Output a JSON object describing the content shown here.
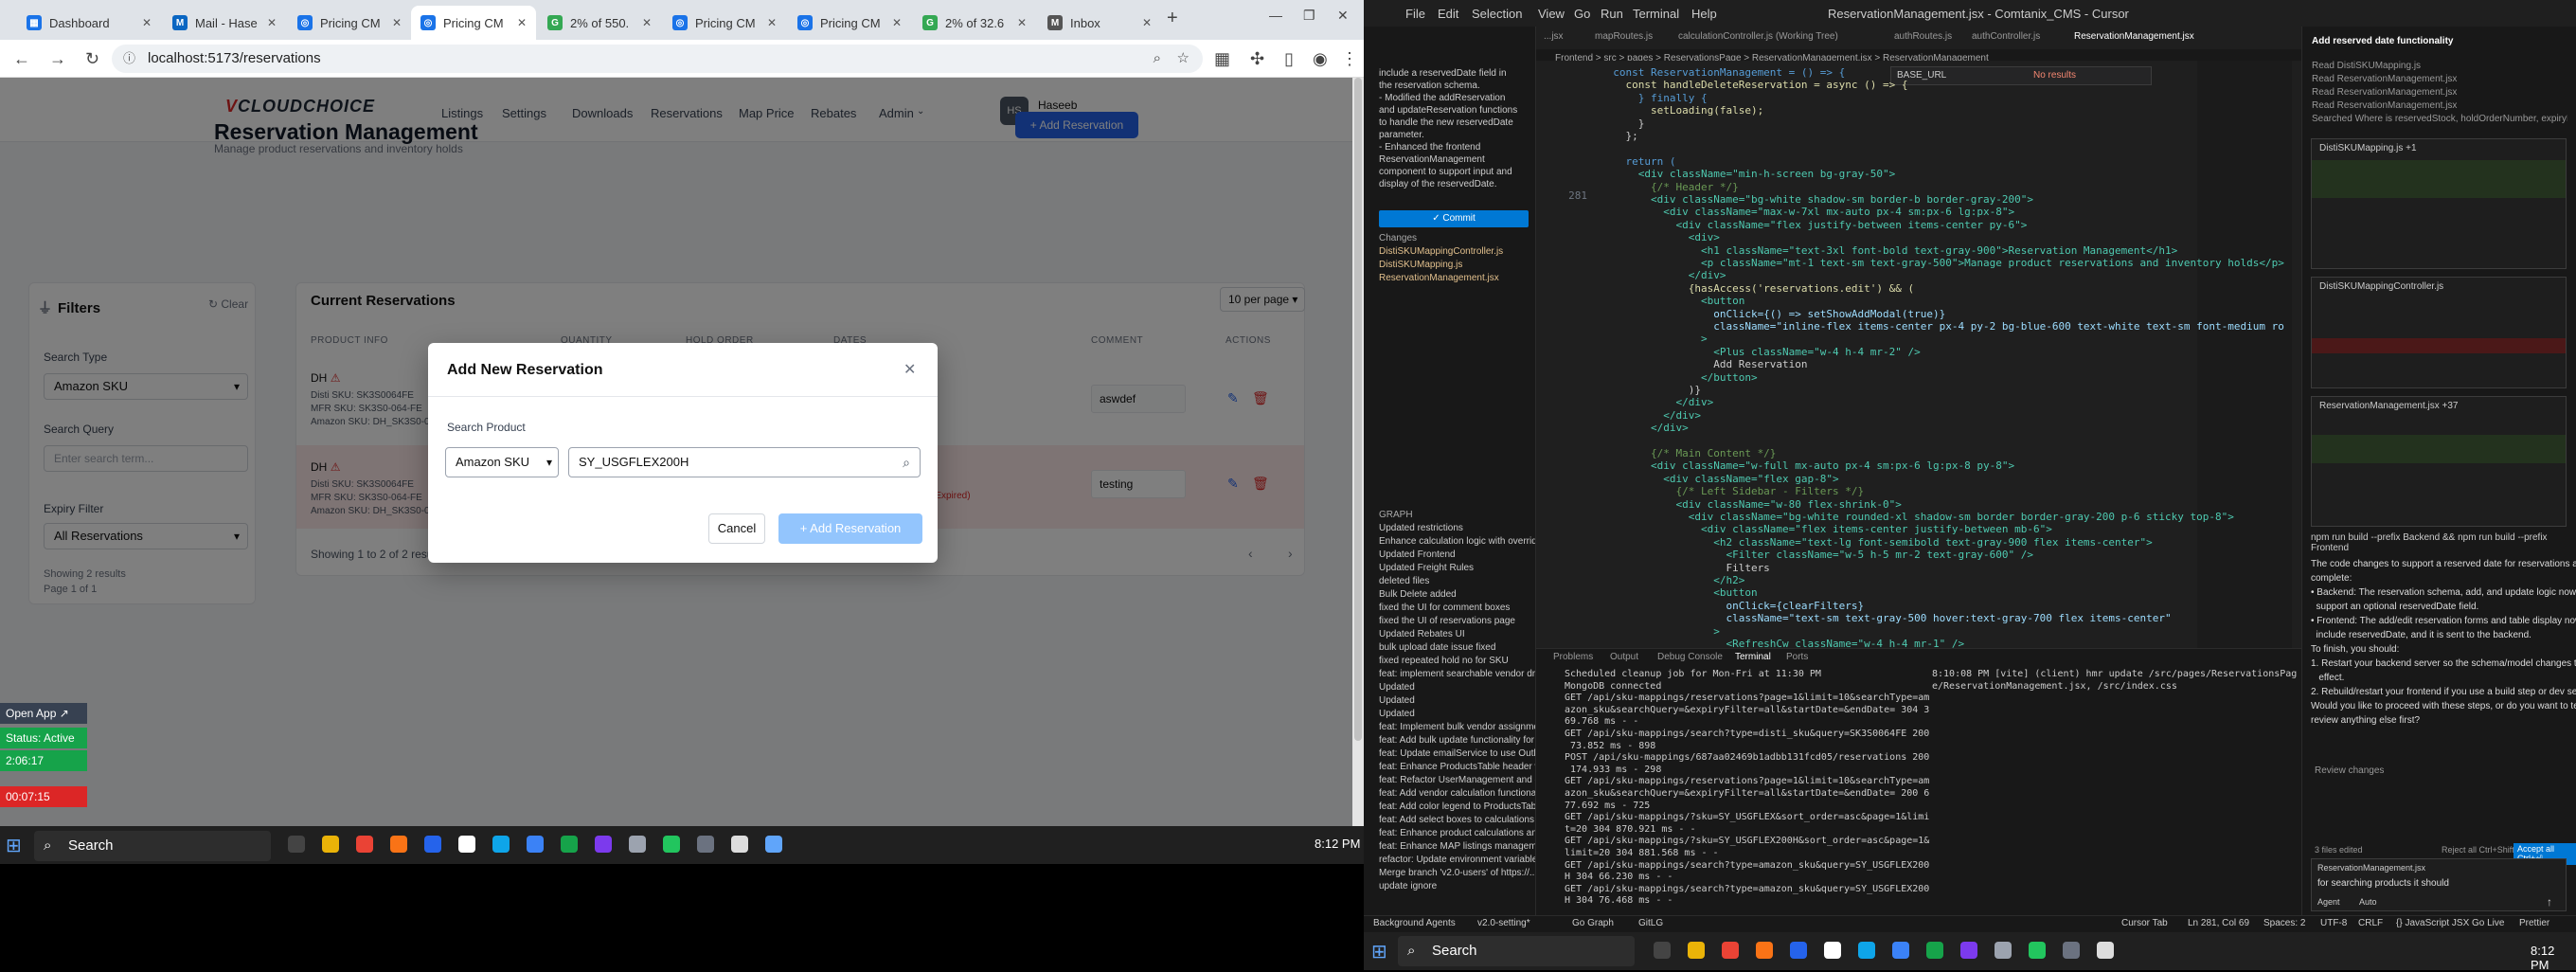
{
  "browser": {
    "tabs": [
      {
        "label": "Dashboard",
        "color": "#1a73e8"
      },
      {
        "label": "Mail - Hase",
        "color": "#0a66c2"
      },
      {
        "label": "Pricing CM",
        "color": "#1a73e8"
      },
      {
        "label": "Pricing CM",
        "color": "#1a73e8"
      },
      {
        "label": "2% of 550.",
        "color": "#34a853"
      },
      {
        "label": "Pricing CM",
        "color": "#1a73e8"
      },
      {
        "label": "Pricing CM",
        "color": "#1a73e8"
      },
      {
        "label": "2% of 32.6",
        "color": "#34a853"
      },
      {
        "label": "Inbox",
        "color": "#555"
      }
    ],
    "url": "localhost:5173/reservations"
  },
  "app": {
    "logo_v": "V",
    "logo_text": "CLOUDCHOICE",
    "nav": [
      "Listings",
      "Settings",
      "Downloads",
      "Reservations",
      "Map Price",
      "Rebates",
      "Admin"
    ],
    "user": {
      "initials": "HS",
      "name": "Haseeb Shah...",
      "role": "admin"
    },
    "title": "Reservation Management",
    "subtitle": "Manage product reservations and inventory holds",
    "add_button": "+ Add Reservation",
    "filters": {
      "title": "Filters",
      "clear": "Clear",
      "search_type_label": "Search Type",
      "search_type_value": "Amazon SKU",
      "search_query_label": "Search Query",
      "search_query_placeholder": "Enter search term...",
      "expiry_label": "Expiry Filter",
      "expiry_value": "All Reservations",
      "results": "Showing 2 results",
      "page": "Page 1 of 1"
    },
    "table": {
      "title": "Current Reservations",
      "per_page": "10 per page",
      "headers": [
        "PRODUCT INFO",
        "QUANTITY",
        "HOLD ORDER",
        "DATES",
        "COMMENT",
        "ACTIONS"
      ],
      "rows": [
        {
          "name": "DH",
          "l1": "Disti SKU: SK3S0064FE",
          "l2": "MFR SKU: SK3S0-064-FE",
          "l3": "Amazon SKU: DH_SK3S0-064...",
          "comment": "aswdef",
          "bg": "#ffffff",
          "note": ""
        },
        {
          "name": "DH",
          "l1": "Disti SKU: SK3S0064FE",
          "l2": "MFR SKU: SK3S0-064-FE",
          "l3": "Amazon SKU: DH_SK3S0-064...",
          "comment": "testing",
          "bg": "#fde8e8",
          "note": "(Expired)"
        }
      ],
      "showing": "Showing 1 to 2 of 2 results"
    },
    "modal": {
      "title": "Add New Reservation",
      "search_label": "Search Product",
      "type_value": "Amazon SKU",
      "query_value": "SY_USGFLEX200H",
      "cancel": "Cancel",
      "add": "+ Add Reservation"
    },
    "widget": {
      "open": "Open App ↗",
      "status": "Status: Active",
      "t1": "2:06:17",
      "t2": "00:07:15"
    }
  },
  "taskbar_left": {
    "search": "Search",
    "time": "8:12 PM"
  },
  "vscode": {
    "menu": [
      "File",
      "Edit",
      "Selection",
      "View",
      "Go",
      "Run",
      "Terminal",
      "Help"
    ],
    "window_title": "ReservationManagement.jsx - Comtanix_CMS - Cursor",
    "tabs": [
      "...jsx",
      "mapRoutes.js",
      "calculationController.js (Working Tree)",
      "authRoutes.js",
      "authController.js",
      "ReservationManagement.jsx"
    ],
    "breadcrumb": "Frontend > src > pages > ReservationsPage > ReservationManagement.jsx > ReservationManagement",
    "find_value": "BASE_URL",
    "find_result": "No results",
    "sidebar_msg": [
      "include a reservedDate field in",
      "the reservation schema.",
      "- Modified the addReservation",
      "and updateReservation functions",
      "to handle the new reservedDate",
      "parameter.",
      "- Enhanced the frontend",
      "ReservationManagement",
      "component to support input and",
      "display of the reservedDate."
    ],
    "commit": "✓ Commit",
    "changes_title": "Changes",
    "changes": [
      "DistiSKUMappingController.js",
      "DistiSKUMapping.js",
      "ReservationManagement.jsx"
    ],
    "graph_title": "GRAPH",
    "graph": [
      "Updated restrictions",
      "Enhance calculation logic with override...",
      "Updated Frontend",
      "Updated Freight Rules",
      "deleted files",
      "Bulk Delete added",
      "fixed the UI for comment boxes",
      "fixed the UI of reservations page",
      "Updated Rebates UI",
      "bulk upload date issue fixed",
      "fixed repeated hold no for SKU",
      "feat: implement searchable vendor dro...",
      "Updated",
      "Updated",
      "Updated",
      "feat: Implement bulk vendor assignmen...",
      "feat: Add bulk update functionality for ...",
      "feat: Update emailService to use Outlook...",
      "feat: Enhance ProductsTable header wit...",
      "feat: Refactor UserManagement and en...",
      "feat: Add vendor calculation functional...",
      "feat: Add color legend to ProductsTable...",
      "feat: Add select boxes to calculations to...",
      "feat: Enhance product calculations and ...",
      "feat: Enhance MAP listings managemen...",
      "refactor: Update environment variable ...",
      "Merge branch 'v2.0-users' of https://...",
      "update ignore"
    ],
    "lines": [
      "281"
    ],
    "code": [
      {
        "t": "  const ReservationManagement = () => {",
        "c": "kw"
      },
      {
        "t": "    const handleDeleteReservation = async () => {",
        "c": "fn"
      },
      {
        "t": "      } finally {",
        "c": "kw"
      },
      {
        "t": "        setLoading(false);",
        "c": "fn"
      },
      {
        "t": "      }",
        "c": ""
      },
      {
        "t": "    };",
        "c": ""
      },
      {
        "t": "",
        "c": ""
      },
      {
        "t": "    return (",
        "c": "kw"
      },
      {
        "t": "      <div className=\"min-h-screen bg-gray-50\">",
        "c": "tag"
      },
      {
        "t": "        {/* Header */}",
        "c": "cm"
      },
      {
        "t": "        <div className=\"bg-white shadow-sm border-b border-gray-200\">",
        "c": "tag"
      },
      {
        "t": "          <div className=\"max-w-7xl mx-auto px-4 sm:px-6 lg:px-8\">",
        "c": "tag"
      },
      {
        "t": "            <div className=\"flex justify-between items-center py-6\">",
        "c": "tag"
      },
      {
        "t": "              <div>",
        "c": "tag"
      },
      {
        "t": "                <h1 className=\"text-3xl font-bold text-gray-900\">Reservation Management</h1>",
        "c": "tag"
      },
      {
        "t": "                <p className=\"mt-1 text-sm text-gray-500\">Manage product reservations and inventory holds</p>",
        "c": "tag"
      },
      {
        "t": "              </div>",
        "c": "tag"
      },
      {
        "t": "              {hasAccess('reservations.edit') && (",
        "c": "fn"
      },
      {
        "t": "                <button",
        "c": "tag"
      },
      {
        "t": "                  onClick={() => setShowAddModal(true)}",
        "c": "at"
      },
      {
        "t": "                  className=\"inline-flex items-center px-4 py-2 bg-blue-600 text-white text-sm font-medium ro",
        "c": "at"
      },
      {
        "t": "                >",
        "c": "tag"
      },
      {
        "t": "                  <Plus className=\"w-4 h-4 mr-2\" />",
        "c": "tag"
      },
      {
        "t": "                  Add Reservation",
        "c": ""
      },
      {
        "t": "                </button>",
        "c": "tag"
      },
      {
        "t": "              )}",
        "c": ""
      },
      {
        "t": "            </div>",
        "c": "tag"
      },
      {
        "t": "          </div>",
        "c": "tag"
      },
      {
        "t": "        </div>",
        "c": "tag"
      },
      {
        "t": "",
        "c": ""
      },
      {
        "t": "        {/* Main Content */}",
        "c": "cm"
      },
      {
        "t": "        <div className=\"w-full mx-auto px-4 sm:px-6 lg:px-8 py-8\">",
        "c": "tag"
      },
      {
        "t": "          <div className=\"flex gap-8\">",
        "c": "tag"
      },
      {
        "t": "            {/* Left Sidebar - Filters */}",
        "c": "cm"
      },
      {
        "t": "            <div className=\"w-80 flex-shrink-0\">",
        "c": "tag"
      },
      {
        "t": "              <div className=\"bg-white rounded-xl shadow-sm border border-gray-200 p-6 sticky top-8\">",
        "c": "tag"
      },
      {
        "t": "                <div className=\"flex items-center justify-between mb-6\">",
        "c": "tag"
      },
      {
        "t": "                  <h2 className=\"text-lg font-semibold text-gray-900 flex items-center\">",
        "c": "tag"
      },
      {
        "t": "                    <Filter className=\"w-5 h-5 mr-2 text-gray-600\" />",
        "c": "tag"
      },
      {
        "t": "                    Filters",
        "c": ""
      },
      {
        "t": "                  </h2>",
        "c": "tag"
      },
      {
        "t": "                  <button",
        "c": "tag"
      },
      {
        "t": "                    onClick={clearFilters}",
        "c": "at"
      },
      {
        "t": "                    className=\"text-sm text-gray-500 hover:text-gray-700 flex items-center\"",
        "c": "at"
      },
      {
        "t": "                  >",
        "c": "tag"
      },
      {
        "t": "                    <RefreshCw className=\"w-4 h-4 mr-1\" />",
        "c": "tag"
      }
    ],
    "panel_tabs": [
      "Problems",
      "Output",
      "Debug Console",
      "Terminal",
      "Ports"
    ],
    "terminal_left": [
      "Scheduled cleanup job for Mon-Fri at 11:30 PM",
      "MongoDB connected",
      "GET /api/sku-mappings/reservations?page=1&limit=10&searchType=am",
      "azon_sku&searchQuery=&expiryFilter=all&startDate=&endDate= 304 3",
      "69.768 ms - -",
      "GET /api/sku-mappings/search?type=disti_sku&query=SK3S0064FE 200",
      " 73.852 ms - 898",
      "POST /api/sku-mappings/687aa02469b1adbb131fcd05/reservations 200",
      " 174.933 ms - 298",
      "GET /api/sku-mappings/reservations?page=1&limit=10&searchType=am",
      "azon_sku&searchQuery=&expiryFilter=all&startDate=&endDate= 200 6",
      "77.692 ms - 725",
      "GET /api/sku-mappings/?sku=SY_USGFLEX&sort_order=asc&page=1&limi",
      "t=20 304 870.921 ms - -",
      "GET /api/sku-mappings/?sku=SY_USGFLEX200H&sort_order=asc&page=1&",
      "limit=20 304 881.568 ms - -",
      "GET /api/sku-mappings/search?type=amazon_sku&query=SY_USGFLEX200",
      "H 304 66.230 ms - -",
      "GET /api/sku-mappings/search?type=amazon_sku&query=SY_USGFLEX200",
      "H 304 76.468 ms - -"
    ],
    "terminal_right": [
      "8:10:08 PM [vite] (client) hmr update /src/pages/ReservationsPag",
      "e/ReservationManagement.jsx, /src/index.css"
    ],
    "chat": {
      "title": "Add reserved date functionality",
      "read_lines": [
        "Read DistiSKUMapping.js",
        "Read ReservationManagement.jsx",
        "Read ReservationManagement.jsx",
        "Read ReservationManagement.jsx",
        "Searched Where is reservedStock, holdOrderNumber, expiryDate, or co..."
      ],
      "file1": "DistiSKUMapping.js +1",
      "file2": "DistiSKUMappingController.js",
      "file3": "ReservationManagement.jsx +37",
      "cmd": "npm run build --prefix Backend && npm run build --prefix Frontend",
      "summary": [
        "The code changes to support a reserved date for reservations are",
        "complete:",
        "• Backend: The reservation schema, add, and update logic now",
        "  support an optional reservedDate field.",
        "• Frontend: The add/edit reservation forms and table display now",
        "  include reservedDate, and it is sent to the backend.",
        "To finish, you should:",
        "1. Restart your backend server so the schema/model changes take",
        "   effect.",
        "2. Rebuild/restart your frontend if you use a build step or dev server.",
        "Would you like to proceed with these steps, or do you want to test or",
        "review anything else first?"
      ],
      "review": "Review changes",
      "files_edited": "3 files edited",
      "reject": "Reject all Ctrl+Shift+⌫",
      "accept": "Accept all Ctrl+⏎",
      "input_tag": "ReservationManagement.jsx",
      "input_text": "for searching products it should",
      "agent": "Agent",
      "auto": "Auto"
    },
    "status": [
      "Background Agents",
      "v2.0-setting*",
      "Go Graph",
      "GitLG",
      "Cursor Tab",
      "Ln 281, Col 69",
      "Spaces: 2",
      "UTF-8",
      "CRLF",
      "{} JavaScript JSX",
      "Go Live",
      "Prettier"
    ],
    "taskbar_search": "Search",
    "taskbar_time": "8:12 PM"
  }
}
